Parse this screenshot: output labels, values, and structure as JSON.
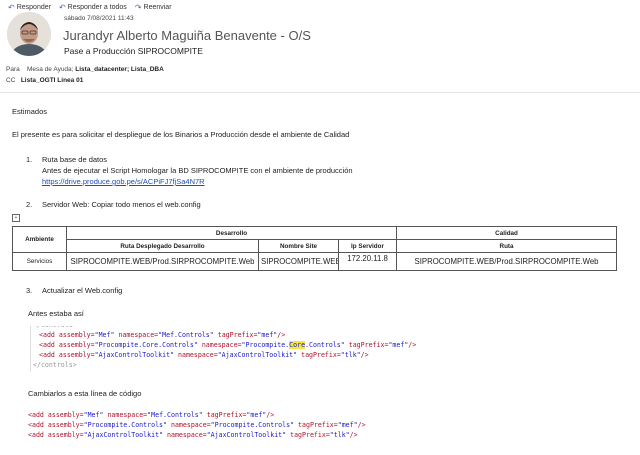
{
  "toolbar": {
    "reply": "Responder",
    "reply_all": "Responder a todos",
    "forward": "Reenviar"
  },
  "email": {
    "date": "sábado 7/08/2021 11:43",
    "sender": "Jurandyr Alberto Maguiña Benavente - O/S",
    "subject": "Pase a Producción SIPROCOMPITE",
    "to_label": "Para",
    "to_value_prefix": "Mesa de Ayuda;",
    "to_value_bold": "Lista_datacenter; Lista_DBA",
    "cc_label": "CC",
    "cc_value": "Lista_OGTI Linea 01"
  },
  "body": {
    "greeting": "Estimados",
    "intro": "El presente es para solicitar el despliegue de los Binarios a Producción desde el ambiente de Calidad",
    "step1_num": "1.",
    "step1_title": "Ruta base de datos",
    "step1_desc": "Antes de ejecutar el Script Homologar la BD SIPROCOMPITE con el ambiente de producción",
    "step1_link": "https://drive.produce.gob.pe/s/ACPiFJ7fjSa4N7R",
    "step2_num": "2.",
    "step2_title": "Servidor Web: Copiar todo menos el web.config",
    "step3_num": "3.",
    "step3_title": "Actualizar el Web.config",
    "before_label": "Antes estaba así",
    "change_label": "Cambiarlos a esta línea de código"
  },
  "table": {
    "h_ambiente": "Ambiente",
    "h_desarrollo": "Desarrollo",
    "h_calidad": "Calidad",
    "sh_ruta_dev": "Ruta Desplegado Desarrollo",
    "sh_nombre_site": "Nombre Site",
    "sh_ip": "Ip Servidor",
    "sh_ruta": "Ruta",
    "r_ambiente": "Servicios",
    "r_ruta_dev": "SIPROCOMPITE.WEB/Prod.SIRPROCOMPITE.Web",
    "r_nombre_site": "SIPROCOMPITE.WEB",
    "r_ip": "172.20.11.8",
    "r_ruta": "SIPROCOMPITE.WEB/Prod.SIRPROCOMPITE.Web"
  },
  "code_before": {
    "l1_assembly": "\"Mef\"",
    "l1_ns": "\"Mef.Controls\"",
    "l1_prefix": "\"mef\"",
    "l2_assembly": "\"Procompite.Core.Controls\"",
    "l2_ns_a": "\"Procompite.",
    "l2_ns_hl": "Core",
    "l2_ns_b": ".Controls\"",
    "l2_prefix": "\"mef\"",
    "l3_assembly": "\"AjaxControlToolkit\"",
    "l3_ns": "\"AjaxControlToolkit\"",
    "l3_prefix": "\"tlk\""
  },
  "code_after": {
    "l1_assembly": "\"Mef\"",
    "l1_ns": "\"Mef.Controls\"",
    "l1_prefix": "\"mef\"",
    "l2_assembly": "\"Procompite.Controls\"",
    "l2_ns": "\"Procompite.Controls\"",
    "l2_prefix": "\"mef\"",
    "l3_assembly": "\"AjaxControlToolkit\"",
    "l3_ns": "\"AjaxControlToolkit\"",
    "l3_prefix": "\"tlk\""
  },
  "syntax": {
    "open": "<add",
    "assembly": "assembly=",
    "namespace": "namespace=",
    "tagprefix": "tagPrefix=",
    "close": "/>"
  },
  "colors": {
    "link": "#1f4fb5",
    "tag": "#b0112a",
    "value": "#1a1acc",
    "highlight": "#f6e53a"
  }
}
